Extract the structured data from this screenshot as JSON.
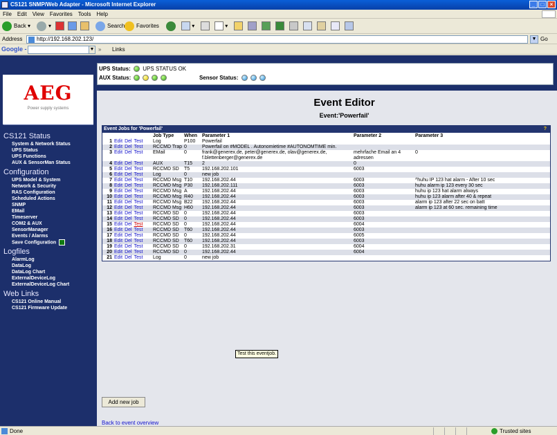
{
  "window": {
    "title": "CS121 SNMP/Web Adapter - Microsoft Internet Explorer"
  },
  "menu": [
    "File",
    "Edit",
    "View",
    "Favorites",
    "Tools",
    "Help"
  ],
  "toolbar": {
    "back": "Back",
    "search": "Search",
    "favorites": "Favorites"
  },
  "address": {
    "label": "Address",
    "url": "http://192.168.202.123/",
    "go": "Go"
  },
  "googlebar": {
    "logo": "Google -",
    "more": "»",
    "links": "Links"
  },
  "logo": {
    "brand": "AEG",
    "tagline": "Power supply systems"
  },
  "status": {
    "ups_label": "UPS Status:",
    "ups_text": "UPS STATUS OK",
    "aux_label": "AUX Status:",
    "sensor_label": "Sensor Status:",
    "colors": {
      "green": "#2c9e13",
      "yellow": "#e0c000",
      "blue": "#1d8ad6"
    }
  },
  "sidebar": {
    "sections": [
      {
        "title": "CS121 Status",
        "items": [
          "System & Network Status",
          "UPS Status",
          "UPS Functions",
          "AUX & SensorMan Status"
        ]
      },
      {
        "title": "Configuration",
        "items": [
          "UPS Model & System",
          "Network & Security",
          "RAS Configuration",
          "Scheduled Actions",
          "SNMP",
          "EMail",
          "Timeserver",
          "COM2 & AUX",
          "SensorManager",
          "Events / Alarms",
          "Save Configuration"
        ]
      },
      {
        "title": "Logfiles",
        "items": [
          "AlarmLog",
          "DataLog",
          "DataLog Chart",
          "ExternalDeviceLog",
          "ExternalDeviceLog Chart"
        ]
      },
      {
        "title": "Web Links",
        "items": [
          "CS121 Online Manual",
          "CS121 Firmware Update"
        ]
      }
    ]
  },
  "editor": {
    "title": "Event Editor",
    "subtitle": "Event:'Powerfail'",
    "table_title": "Event Jobs for 'Powerfail'",
    "help": "?",
    "columns": [
      "",
      "",
      "Job Type",
      "When",
      "Parameter 1",
      "Parameter 2",
      "Parameter 3"
    ],
    "actions": {
      "edit": "Edit",
      "del": "Del",
      "test": "Test"
    },
    "rows": [
      {
        "n": "1",
        "type": "Log",
        "when": "P100",
        "p1": "Powerfail",
        "p2": "",
        "p3": ""
      },
      {
        "n": "2",
        "type": "RCCMD Trap",
        "when": "0",
        "p1": "Powerfail on #MODEL . Autonomietime #AUTONOMTIME min.",
        "p2": "",
        "p3": ""
      },
      {
        "n": "3",
        "type": "EMail",
        "when": "0",
        "p1": "frank@generex.de, peter@generex.de, olav@generex.de, f.blettenberger@generex.de",
        "p2": "mehrfache Email an 4 adressen",
        "p3": "0"
      },
      {
        "n": "4",
        "type": "AUX",
        "when": "T15",
        "p1": "2",
        "p2": "0",
        "p3": ""
      },
      {
        "n": "5",
        "type": "RCCMD SD",
        "when": "T5",
        "p1": "192.168.202.101",
        "p2": "6003",
        "p3": ""
      },
      {
        "n": "6",
        "type": "Log",
        "when": "0",
        "p1": "new job",
        "p2": "",
        "p3": ""
      },
      {
        "n": "7",
        "type": "RCCMD Msg",
        "when": "T10",
        "p1": "192.168.202.44",
        "p2": "6003",
        "p3": "^huhu IP 123 hat alarm - After 10 sec"
      },
      {
        "n": "8",
        "type": "RCCMD Msg",
        "when": "P30",
        "p1": "192.168.202.111",
        "p2": "6003",
        "p3": "huhu alarm ip 123 every 30 sec"
      },
      {
        "n": "9",
        "type": "RCCMD Msg",
        "when": "A",
        "p1": "192.168.202.44",
        "p2": "6003",
        "p3": "huhu ip 123 hat alarm always"
      },
      {
        "n": "10",
        "type": "RCCMD Msg",
        "when": "R40",
        "p1": "192.168.202.44",
        "p2": "6003",
        "p3": "huhu ip 123 alarm after 40 & repeat"
      },
      {
        "n": "11",
        "type": "RCCMD Msg",
        "when": "B22",
        "p1": "192.168.202.44",
        "p2": "6003",
        "p3": "alarm ip 123 after 22 sec on batt"
      },
      {
        "n": "12",
        "type": "RCCMD Msg",
        "when": "H60",
        "p1": "192.168.202.44",
        "p2": "6003",
        "p3": "alarm ip 123 at 60 sec. remaining time"
      },
      {
        "n": "13",
        "type": "RCCMD SD",
        "when": "0",
        "p1": "192.168.202.44",
        "p2": "6003",
        "p3": ""
      },
      {
        "n": "14",
        "type": "RCCMD SD",
        "when": "0",
        "p1": "192.168.202.44",
        "p2": "6003",
        "p3": ""
      },
      {
        "n": "15",
        "type": "RCCMD SD",
        "when": "0",
        "p1": "192.168.202.44",
        "p2": "6004",
        "p3": ""
      },
      {
        "n": "16",
        "type": "RCCMD SD",
        "when": "T60",
        "p1": "192.168.202.44",
        "p2": "6003",
        "p3": ""
      },
      {
        "n": "17",
        "type": "RCCMD SD",
        "when": "0",
        "p1": "192.168.202.44",
        "p2": "6005",
        "p3": ""
      },
      {
        "n": "18",
        "type": "RCCMD SD",
        "when": "T60",
        "p1": "192.168.202.44",
        "p2": "6003",
        "p3": ""
      },
      {
        "n": "19",
        "type": "RCCMD SD",
        "when": "0",
        "p1": "192.168.202.31",
        "p2": "6004",
        "p3": ""
      },
      {
        "n": "20",
        "type": "RCCMD SD",
        "when": "0",
        "p1": "192.168.202.44",
        "p2": "6004",
        "p3": ""
      },
      {
        "n": "21",
        "type": "Log",
        "when": "0",
        "p1": "new job",
        "p2": "",
        "p3": ""
      }
    ],
    "tooltip": "Test this eventjob.",
    "add_button": "Add new job",
    "back_link": "Back to event overview"
  },
  "statusbar": {
    "done": "Done",
    "zone": "Trusted sites"
  }
}
